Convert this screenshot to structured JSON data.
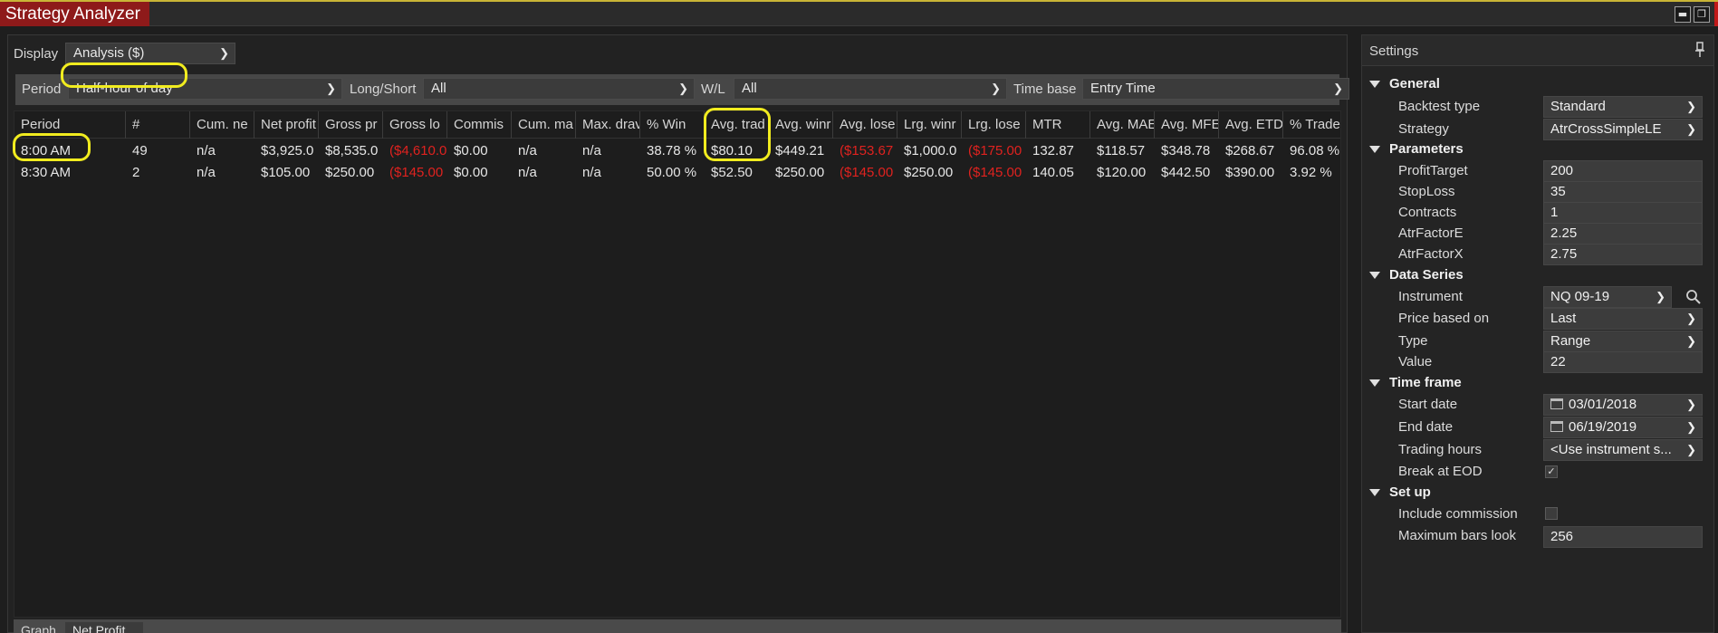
{
  "window": {
    "title": "Strategy Analyzer",
    "minimize_glyph": "▬",
    "restore_glyph": "❐"
  },
  "display": {
    "label": "Display",
    "value": "Analysis ($)"
  },
  "filters": {
    "period": {
      "label": "Period",
      "value": "Half-hour of day"
    },
    "long_short": {
      "label": "Long/Short",
      "value": "All"
    },
    "wl": {
      "label": "W/L",
      "value": "All"
    },
    "time_base": {
      "label": "Time base",
      "value": "Entry Time"
    }
  },
  "grid": {
    "columns": [
      "Period",
      "#",
      "Cum. ne",
      "Net profit",
      "Gross pr",
      "Gross lo",
      "Commis",
      "Cum. ma",
      "Max. drav",
      "% Win",
      "Avg. trad",
      "Avg. winr",
      "Avg. lose",
      "Lrg. winr",
      "Lrg. lose",
      "MTR",
      "Avg. MAE",
      "Avg. MFE",
      "Avg. ETD",
      "% Trade"
    ],
    "rows": [
      [
        "8:00 AM",
        "49",
        "n/a",
        "$3,925.0",
        "$8,535.0",
        "($4,610.0",
        "$0.00",
        "n/a",
        "n/a",
        "38.78 %",
        "$80.10",
        "$449.21",
        "($153.67",
        "$1,000.0",
        "($175.00",
        "132.87",
        "$118.57",
        "$348.78",
        "$268.67",
        "96.08 %"
      ],
      [
        "8:30 AM",
        "2",
        "n/a",
        "$105.00",
        "$250.00",
        "($145.00",
        "$0.00",
        "n/a",
        "n/a",
        "50.00 %",
        "$52.50",
        "$250.00",
        "($145.00",
        "$250.00",
        "($145.00",
        "140.05",
        "$120.00",
        "$442.50",
        "$390.00",
        "3.92 %"
      ]
    ]
  },
  "graph": {
    "label": "Graph",
    "value": "Net Profit"
  },
  "colors": {
    "negative": "#e0221f",
    "highlight": "#f1ec1f",
    "title_bg": "#8e1a1a"
  },
  "settings": {
    "title": "Settings",
    "pin_icon": "pin-icon",
    "sections": {
      "general": "General",
      "parameters": "Parameters",
      "data_series": "Data Series",
      "time_frame": "Time frame",
      "set_up": "Set up"
    },
    "fields": {
      "backtest_type": {
        "label": "Backtest type",
        "value": "Standard"
      },
      "strategy": {
        "label": "Strategy",
        "value": "AtrCrossSimpleLE"
      },
      "profit_target": {
        "label": "ProfitTarget",
        "value": "200"
      },
      "stop_loss": {
        "label": "StopLoss",
        "value": "35"
      },
      "contracts": {
        "label": "Contracts",
        "value": "1"
      },
      "atr_factor_e": {
        "label": "AtrFactorE",
        "value": "2.25"
      },
      "atr_factor_x": {
        "label": "AtrFactorX",
        "value": "2.75"
      },
      "instrument": {
        "label": "Instrument",
        "value": "NQ 09-19"
      },
      "price_based_on": {
        "label": "Price based on",
        "value": "Last"
      },
      "type": {
        "label": "Type",
        "value": "Range"
      },
      "value": {
        "label": "Value",
        "value": "22"
      },
      "start_date": {
        "label": "Start date",
        "value": "03/01/2018"
      },
      "end_date": {
        "label": "End date",
        "value": "06/19/2019"
      },
      "trading_hours": {
        "label": "Trading hours",
        "value": "<Use instrument s..."
      },
      "break_at_eod": {
        "label": "Break at EOD",
        "checked": true
      },
      "include_commission": {
        "label": "Include commission",
        "checked": false
      },
      "max_bars_look": {
        "label": "Maximum bars look",
        "value": "256"
      }
    }
  }
}
